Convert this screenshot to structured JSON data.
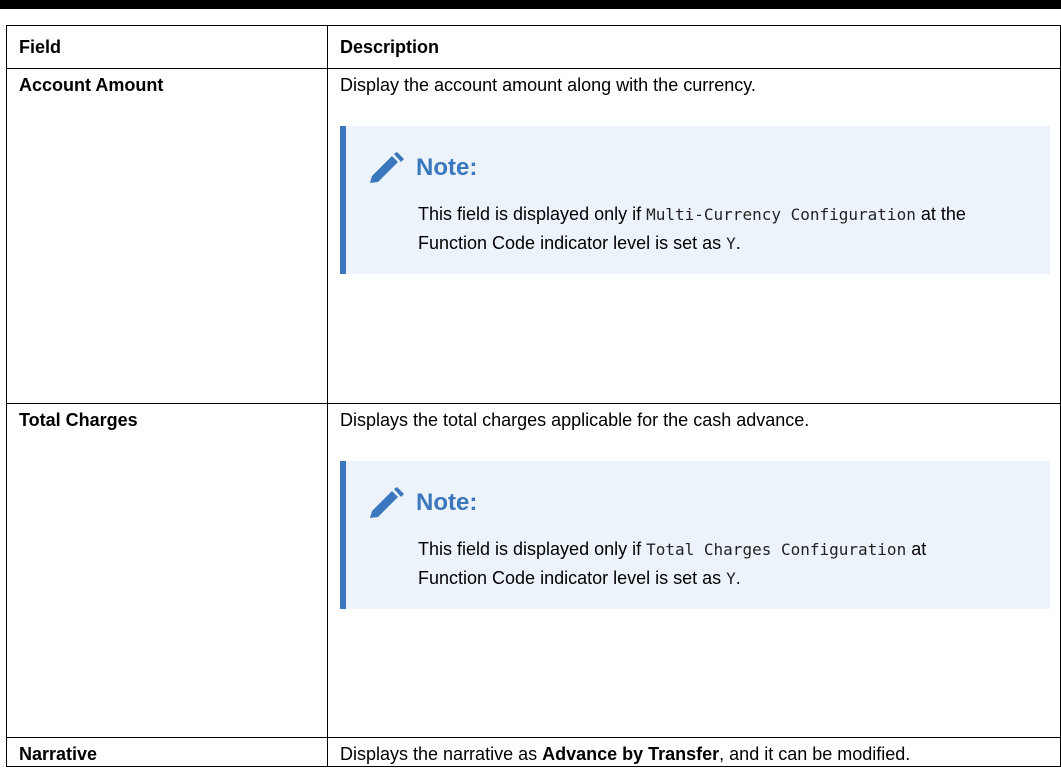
{
  "table": {
    "headers": [
      "Field",
      "Description"
    ],
    "rows": [
      {
        "field": "Account Amount",
        "description": "Display the account amount along with the currency.",
        "note": {
          "title": "Note:",
          "pre": "This field is displayed only if ",
          "code1": "Multi-Currency Configuration",
          "mid": " at the Function Code indicator level is set as ",
          "code2": "Y",
          "post": "."
        }
      },
      {
        "field": "Total Charges",
        "description": "Displays the total charges applicable for the cash advance.",
        "note": {
          "title": "Note:",
          "pre": "This field is displayed only if ",
          "code1": "Total Charges Configuration",
          "mid": " at Function Code indicator level is set as ",
          "code2": "Y",
          "post": "."
        }
      },
      {
        "field": "Narrative",
        "description_pre": "Displays the narrative as ",
        "description_bold": "Advance by Transfer",
        "description_post": ", and it can be modified."
      }
    ]
  },
  "colors": {
    "note_accent": "#3a77bd",
    "note_background": "#edf3fa"
  },
  "icons": {
    "note": "pencil-icon"
  }
}
